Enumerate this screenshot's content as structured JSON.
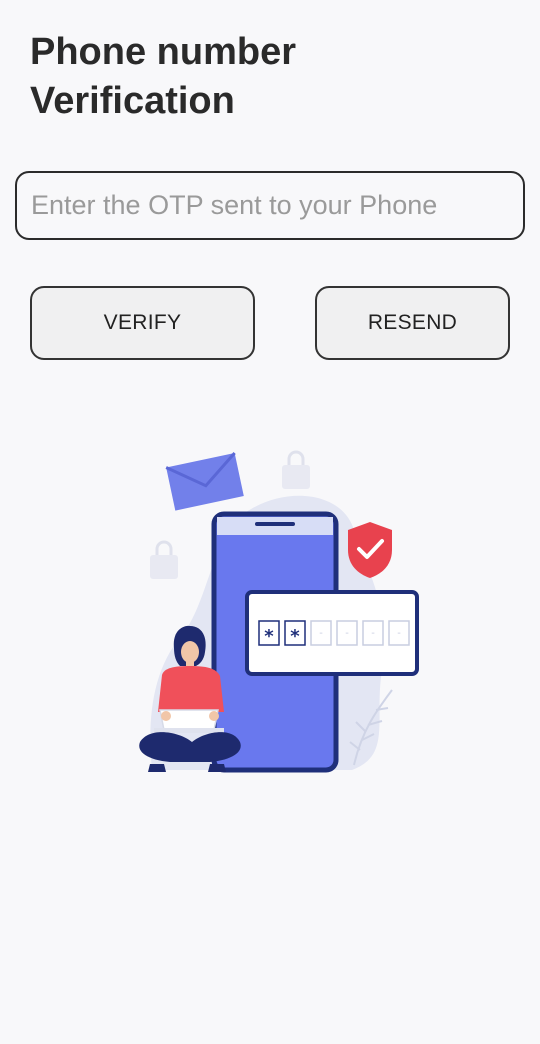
{
  "header": {
    "title_line1": "Phone number",
    "title_line2": "Verification"
  },
  "otp": {
    "placeholder": "Enter the OTP sent to your Phone",
    "value": ""
  },
  "actions": {
    "verify_label": "VERIFY",
    "resend_label": "RESEND"
  },
  "illustration": {
    "otp_digits": [
      "*",
      "*",
      "-",
      "-",
      "-",
      "-"
    ],
    "colors": {
      "primary": "#6f7cf0",
      "phone_border": "#1f2f7a",
      "shield": "#e8424e",
      "person_shirt": "#f0505a",
      "person_pants": "#1e2a6e"
    }
  }
}
